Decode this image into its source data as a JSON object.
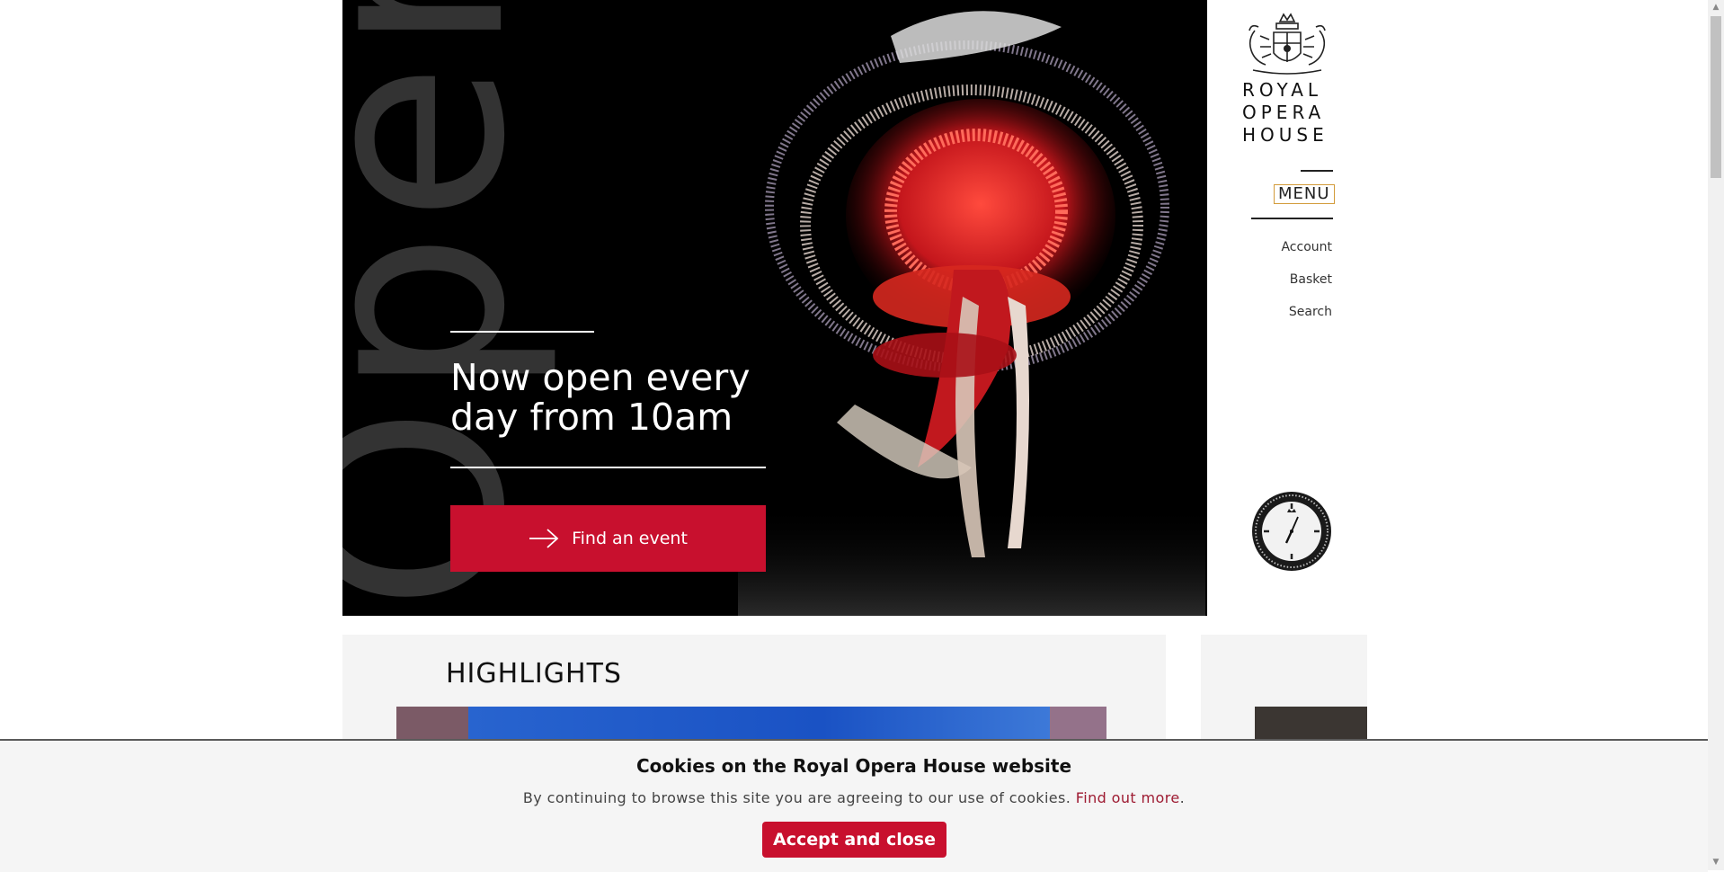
{
  "hero": {
    "background_word": "Open",
    "heading": "Now open every day from 10am",
    "cta_label": "Find an event",
    "cta_icon": "arrow-right-icon",
    "cta_color": "#c8102e"
  },
  "header": {
    "logo_lines": [
      "ROYAL",
      "OPERA",
      "HOUSE"
    ],
    "menu_label": "MENU",
    "links": [
      "Account",
      "Basket",
      "Search"
    ],
    "sponsor_icon": "rolex-clock-icon"
  },
  "highlights": {
    "title": "HIGHLIGHTS"
  },
  "cookie_banner": {
    "title": "Cookies on the Royal Opera House website",
    "text": "By continuing to browse this site you are agreeing to our use of cookies.",
    "link_text": "Find out more",
    "text_end": ".",
    "accept_label": "Accept and close",
    "accent_color": "#c8102e"
  }
}
